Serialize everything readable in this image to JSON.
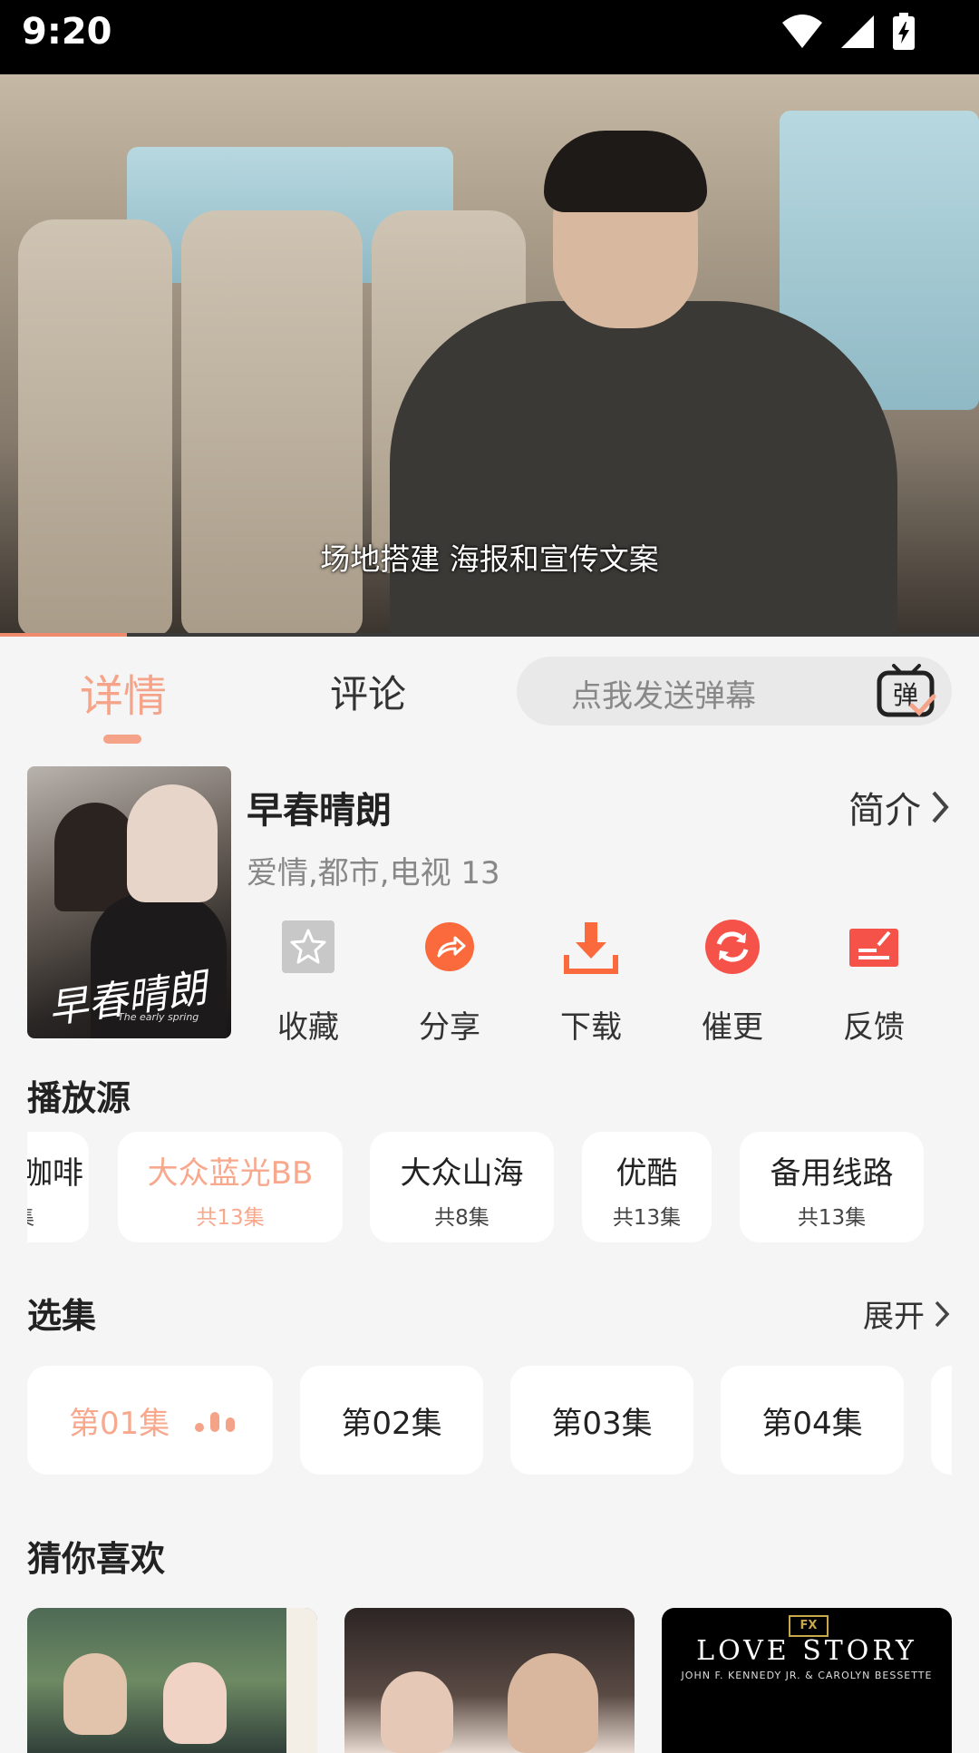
{
  "status_bar": {
    "time": "9:20"
  },
  "player": {
    "subtitle": "场地搭建 海报和宣传文案",
    "progress": 0.13
  },
  "tabs": {
    "detail": "详情",
    "comment": "评论",
    "danmaku_placeholder": "点我发送弹幕",
    "danmaku_icon_text": "弹"
  },
  "show": {
    "title": "早春晴朗",
    "intro_label": "简介",
    "genre": "爱情,都市,电视 13",
    "poster_title": "早春晴朗",
    "poster_subtitle": "The early spring"
  },
  "actions": [
    {
      "label": "收藏",
      "icon": "star-icon"
    },
    {
      "label": "分享",
      "icon": "share-icon"
    },
    {
      "label": "下载",
      "icon": "download-icon"
    },
    {
      "label": "催更",
      "icon": "refresh-icon"
    },
    {
      "label": "反馈",
      "icon": "feedback-icon"
    }
  ],
  "sources_section": {
    "title": "播放源",
    "items": [
      {
        "name": "咖啡",
        "count": "集"
      },
      {
        "name": "大众蓝光BB",
        "count": "共13集",
        "active": true
      },
      {
        "name": "大众山海",
        "count": "共8集"
      },
      {
        "name": "优酷",
        "count": "共13集"
      },
      {
        "name": "备用线路",
        "count": "共13集"
      }
    ]
  },
  "episodes_section": {
    "title": "选集",
    "expand_label": "展开",
    "items": [
      "第01集",
      "第02集",
      "第03集",
      "第04集"
    ]
  },
  "recommend_section": {
    "title": "猜你喜欢",
    "items": [
      {
        "poster_text": ""
      },
      {
        "poster_text": ""
      },
      {
        "poster_brand": "FX",
        "poster_title": "LOVE STORY",
        "poster_subtitle": "JOHN F. KENNEDY JR. & CAROLYN BESSETTE"
      }
    ]
  },
  "colors": {
    "accent": "#f4a288",
    "background": "#f5f5f5",
    "action_gray": "#c8c8c8",
    "action_orange": "#fb6a3c"
  }
}
